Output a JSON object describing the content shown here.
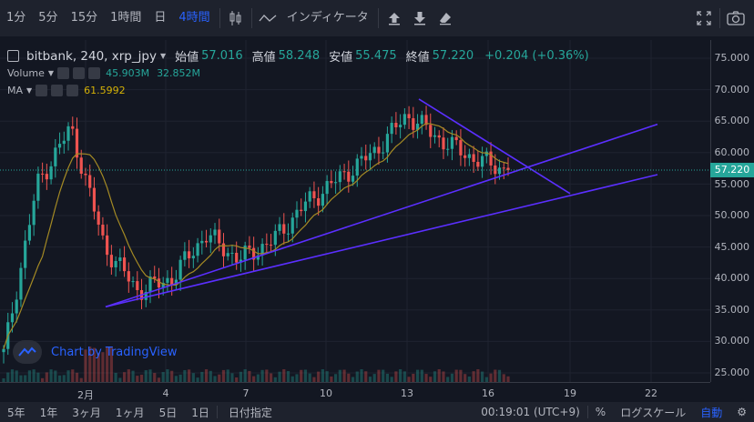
{
  "toolbar": {
    "intervals": [
      "1分",
      "5分",
      "15分",
      "1時間",
      "日",
      "4時間"
    ],
    "active_interval": "4時間",
    "indicators_label": "インディケータ",
    "icons": [
      "candlestick-icon",
      "indicator-wave-icon",
      "upload-icon",
      "download-icon",
      "eraser-icon",
      "fullscreen-icon",
      "camera-icon"
    ]
  },
  "legend": {
    "title": "bitbank, 240, xrp_jpy",
    "open_label": "始値",
    "open": "57.016",
    "high_label": "高値",
    "high": "58.248",
    "low_label": "安値",
    "low": "55.475",
    "close_label": "終値",
    "close": "57.220",
    "change": "+0.204 (+0.36%)",
    "volume_label": "Volume",
    "volume_values": [
      "45.903M",
      "32.852M"
    ],
    "ma_label": "MA",
    "ma_value": "61.5992"
  },
  "watermark": "Chart by TradingView",
  "price_tag": "57.220",
  "colors": {
    "up": "#26a69a",
    "down": "#ef5350",
    "ma": "#a48a24",
    "trend": "#5b2fff",
    "accent": "#2962ff",
    "bg": "#131722"
  },
  "y_axis": {
    "ticks": [
      "75.000",
      "70.000",
      "65.000",
      "60.000",
      "55.000",
      "50.000",
      "45.000",
      "40.000",
      "35.000",
      "30.000",
      "25.000"
    ]
  },
  "x_axis": {
    "ticks": [
      "2月",
      "4",
      "7",
      "10",
      "13",
      "16",
      "19",
      "22"
    ]
  },
  "bottom_bar": {
    "ranges": [
      "5年",
      "1年",
      "3ヶ月",
      "1ヶ月",
      "5日",
      "1日"
    ],
    "goto_date": "日付指定",
    "clock": "00:19:01 (UTC+9)",
    "percent": "%",
    "log_scale": "ログスケール",
    "auto": "自動"
  },
  "chart_data": {
    "type": "candlestick",
    "x_range": [
      "2月",
      "22"
    ],
    "y_range": [
      25,
      75
    ],
    "grid": true,
    "close_keypoints": [
      {
        "x": "1/30",
        "y": 28
      },
      {
        "x": "2/1",
        "y": 55
      },
      {
        "x": "2/2",
        "y": 64
      },
      {
        "x": "2/2",
        "y": 45
      },
      {
        "x": "2/3",
        "y": 38
      },
      {
        "x": "2/5",
        "y": 40
      },
      {
        "x": "2/6",
        "y": 47
      },
      {
        "x": "2/8",
        "y": 43
      },
      {
        "x": "2/9",
        "y": 46
      },
      {
        "x": "2/11",
        "y": 52
      },
      {
        "x": "2/12",
        "y": 56
      },
      {
        "x": "2/13",
        "y": 60
      },
      {
        "x": "2/14",
        "y": 66
      },
      {
        "x": "2/15",
        "y": 62
      },
      {
        "x": "2/16",
        "y": 59
      },
      {
        "x": "2/17",
        "y": 57.22
      }
    ],
    "ma": {
      "name": "MA",
      "last": 61.5992
    },
    "trendlines": [
      {
        "from": {
          "x": "2/2",
          "y": 35.5
        },
        "to": {
          "x": "2/22",
          "y": 56.5
        }
      },
      {
        "from": {
          "x": "2/2",
          "y": 35.5
        },
        "to": {
          "x": "2/22",
          "y": 64.5
        }
      },
      {
        "from": {
          "x": "2/13",
          "y": 68.5
        },
        "to": {
          "x": "2/19",
          "y": 53.5
        }
      }
    ],
    "last_price": 57.22
  }
}
